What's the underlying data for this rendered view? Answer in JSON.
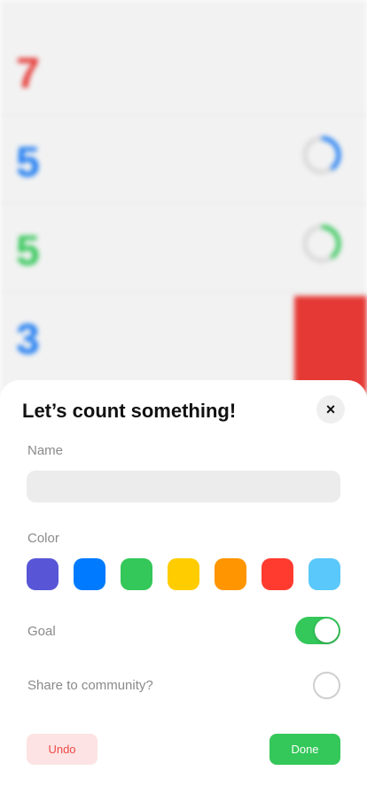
{
  "background_list": {
    "rows": [
      {
        "number": "7",
        "color": "#e53935"
      },
      {
        "number": "5",
        "color": "#1e7cf2",
        "progress": 0.4
      },
      {
        "number": "5",
        "color": "#34c759",
        "progress": 0.4
      },
      {
        "number": "3",
        "color": "#1e7cf2"
      }
    ]
  },
  "sheet": {
    "title": "Let’s count something!",
    "close_icon": "×",
    "name_label": "Name",
    "name_value": "",
    "color_label": "Color",
    "colors": [
      "#5856d6",
      "#007aff",
      "#34c759",
      "#ffcc00",
      "#ff9500",
      "#ff3b30",
      "#5ac8fa"
    ],
    "goal_label": "Goal",
    "goal_enabled": true,
    "share_label": "Share to community?",
    "share_enabled": false,
    "undo_label": "Undo",
    "done_label": "Done"
  }
}
